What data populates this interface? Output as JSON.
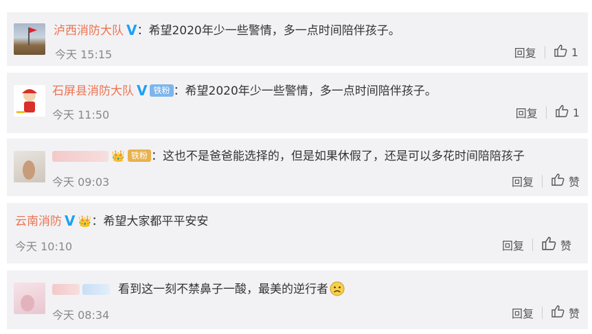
{
  "comments": [
    {
      "name": "泸西消防大队",
      "text": "：希望2020年少一些警情，多一点时间陪伴孩子。",
      "time": "今天 15:15",
      "reply": "回复",
      "likes": "1"
    },
    {
      "name": "石屏县消防大队",
      "badge": "铁粉",
      "text": "：希望2020年少一些警情，多一点时间陪伴孩子。",
      "time": "今天 11:50",
      "reply": "回复",
      "likes": "1"
    },
    {
      "badge": "铁粉",
      "text": "：这也不是爸爸能选择的，但是如果休假了，还是可以多花时间陪陪孩子",
      "time": "今天 09:03",
      "reply": "回复",
      "like_label": "赞"
    },
    {
      "name": "云南消防",
      "text": "：希望大家都平平安安",
      "time": "今天 10:10",
      "reply": "回复",
      "like_label": "赞"
    },
    {
      "text": "看到这一刻不禁鼻子一酸，最美的逆行者",
      "time": "今天 08:34",
      "reply": "回复",
      "like_label": "赞"
    }
  ],
  "colors": {
    "name": "#eb7350",
    "verified": "#1da1f2",
    "card_bg": "#f2f2f5"
  },
  "icons": [
    "verified-v-icon",
    "thumb-up-icon",
    "crown-icon",
    "sad-face-emoji-icon"
  ]
}
